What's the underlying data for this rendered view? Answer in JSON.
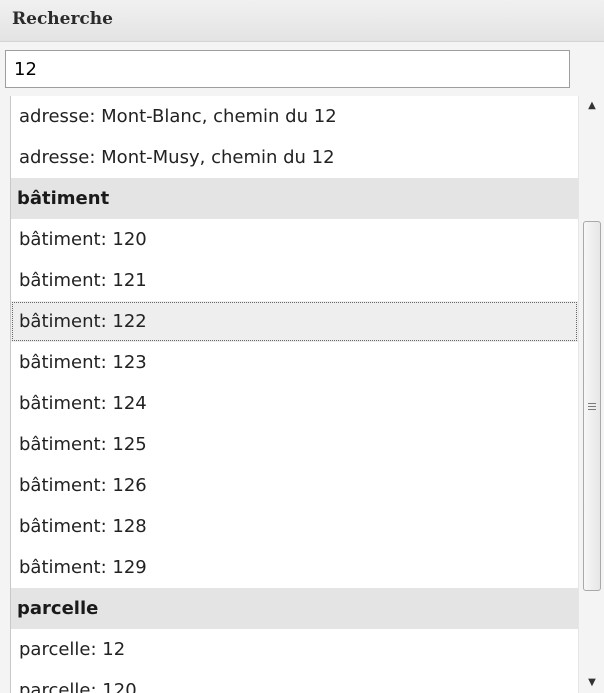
{
  "panel": {
    "title": "Recherche"
  },
  "search": {
    "value": "12"
  },
  "results": {
    "adresse_items": [
      "adresse: Mont-Blanc, chemin du 12",
      "adresse: Mont-Musy, chemin du 12"
    ],
    "batiment_group": "bâtiment",
    "batiment_items": [
      "bâtiment: 120",
      "bâtiment: 121",
      "bâtiment: 122",
      "bâtiment: 123",
      "bâtiment: 124",
      "bâtiment: 125",
      "bâtiment: 126",
      "bâtiment: 128",
      "bâtiment: 129"
    ],
    "parcelle_group": "parcelle",
    "parcelle_items": [
      "parcelle: 12",
      "parcelle: 120"
    ],
    "selected_item": "bâtiment: 122"
  },
  "scrollbar": {
    "up_icon": "arrow-up",
    "down_icon": "arrow-down",
    "grip_icon": "grip-lines"
  }
}
